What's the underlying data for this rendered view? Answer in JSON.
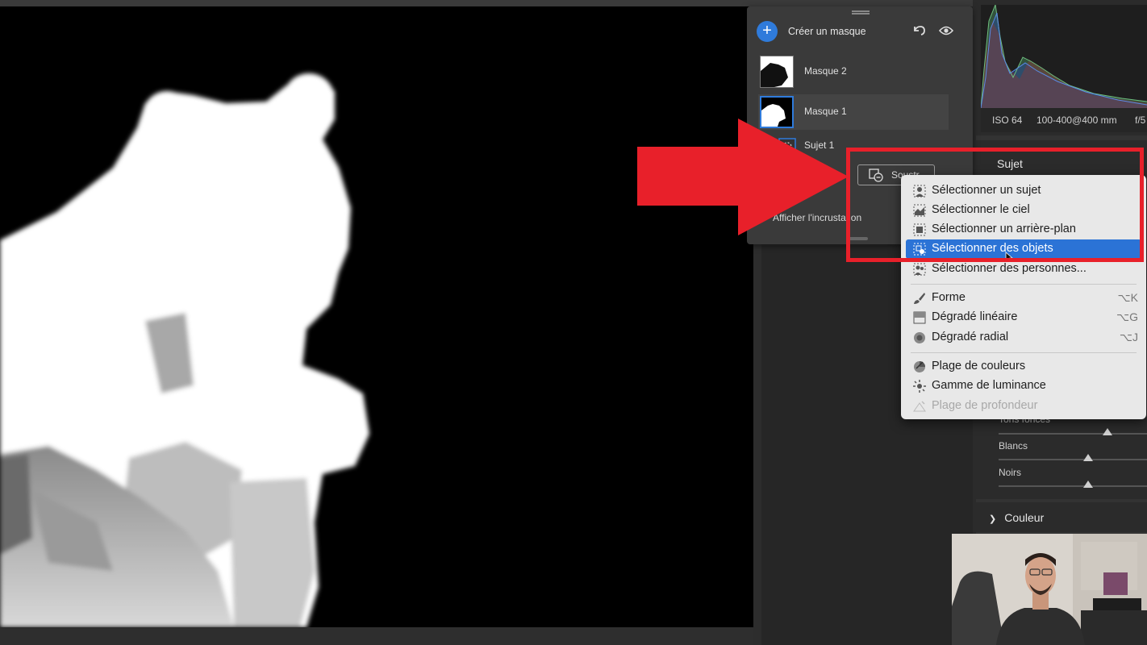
{
  "mask_panel": {
    "create_label": "Créer un masque",
    "masks": [
      {
        "label": "Masque 2"
      },
      {
        "label": "Masque 1"
      }
    ],
    "component_label": "Sujet 1",
    "subtract_label": "Soustr.",
    "overlay_label": "Afficher l'incrustation"
  },
  "right_panel": {
    "camera": {
      "iso": "ISO 64",
      "lens": "100-400@400 mm",
      "aperture": "f/5"
    },
    "section_title": "Sujet",
    "sliders": [
      {
        "label": "Tons foncés",
        "value": 0.73
      },
      {
        "label": "Blancs",
        "value": 0.62
      },
      {
        "label": "Noirs",
        "value": 0.62
      }
    ],
    "color_section": "Couleur"
  },
  "menu": {
    "items": [
      {
        "label": "Sélectionner un sujet",
        "icon": "subject-select-icon"
      },
      {
        "label": "Sélectionner le ciel",
        "icon": "sky-select-icon"
      },
      {
        "label": "Sélectionner un arrière-plan",
        "icon": "background-select-icon"
      },
      {
        "label": "Sélectionner des objets",
        "icon": "objects-select-icon",
        "highlighted": true
      },
      {
        "label": "Sélectionner des personnes...",
        "icon": "people-select-icon"
      },
      {
        "label": "Forme",
        "icon": "brush-icon",
        "shortcut": "⌥K"
      },
      {
        "label": "Dégradé linéaire",
        "icon": "linear-gradient-icon",
        "shortcut": "⌥G"
      },
      {
        "label": "Dégradé radial",
        "icon": "radial-gradient-icon",
        "shortcut": "⌥J"
      },
      {
        "label": "Plage de couleurs",
        "icon": "color-range-icon"
      },
      {
        "label": "Gamme de luminance",
        "icon": "luminance-range-icon"
      },
      {
        "label": "Plage de profondeur",
        "icon": "depth-range-icon",
        "disabled": true
      }
    ]
  },
  "colors": {
    "accent": "#2b73d6",
    "annotation_red": "#e8202a",
    "menu_bg": "#e8e8e8",
    "panel_bg": "#3a3a3a"
  }
}
